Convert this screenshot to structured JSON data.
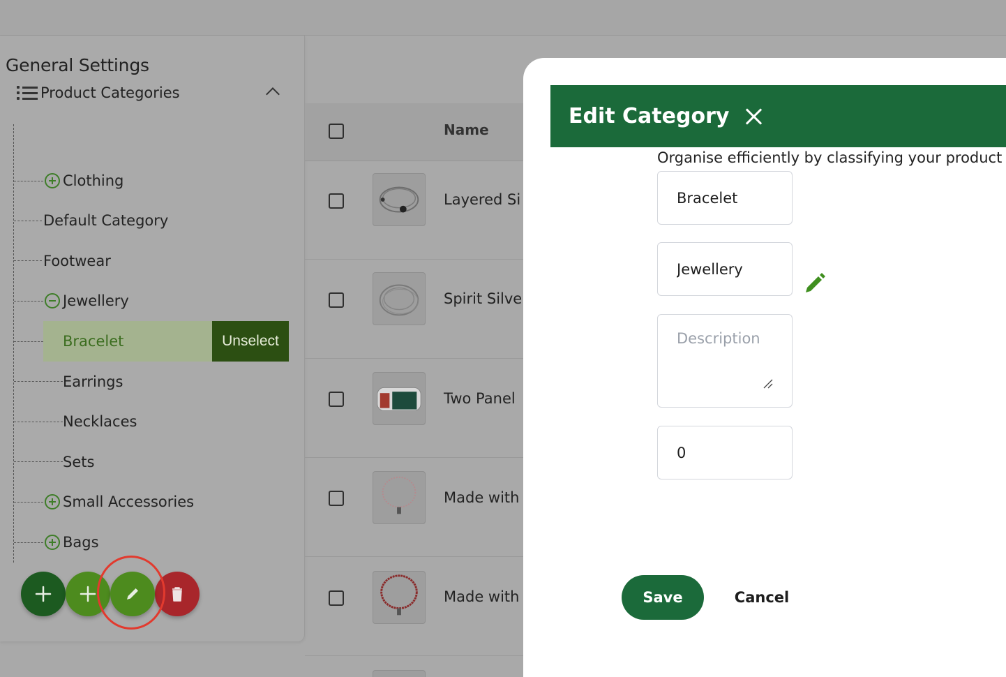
{
  "settings": {
    "title": "General Settings",
    "section_label": "Product Categories",
    "tree": [
      {
        "label": "Clothing",
        "toggle": "expand"
      },
      {
        "label": "Default Category"
      },
      {
        "label": "Footwear"
      },
      {
        "label": "Jewellery",
        "toggle": "collapse"
      },
      {
        "label": "Bracelet",
        "selected": true
      },
      {
        "label": "Earrings"
      },
      {
        "label": "Necklaces"
      },
      {
        "label": "Sets"
      },
      {
        "label": "Small Accessories",
        "toggle": "expand"
      },
      {
        "label": "Bags",
        "toggle": "expand"
      }
    ],
    "unselect_label": "Unselect",
    "fab_buttons": [
      "plus-icon",
      "plus-icon",
      "pencil-icon",
      "trash-icon"
    ],
    "colors": {
      "fab_dark": "#1c5a20",
      "fab_green": "#4d8b1e",
      "fab_red": "#a8262b",
      "highlight_ring": "#e23a2e"
    }
  },
  "table": {
    "name_header": "Name",
    "rows": [
      {
        "name": "Layered Si"
      },
      {
        "name": "Spirit Silve"
      },
      {
        "name": "Two Panel"
      },
      {
        "name": "Made with"
      },
      {
        "name": "Made with"
      }
    ]
  },
  "modal": {
    "title": "Edit Category",
    "subtitle": "Organise efficiently by classifying your product",
    "name_value": "Bracelet",
    "parent_value": "Jewellery",
    "description_placeholder": "Description",
    "order_value": "0",
    "save_label": "Save",
    "cancel_label": "Cancel",
    "colors": {
      "header": "#1b6a3a",
      "save_button": "#1b6a3a",
      "edit_icon": "#3f8f1f"
    }
  }
}
